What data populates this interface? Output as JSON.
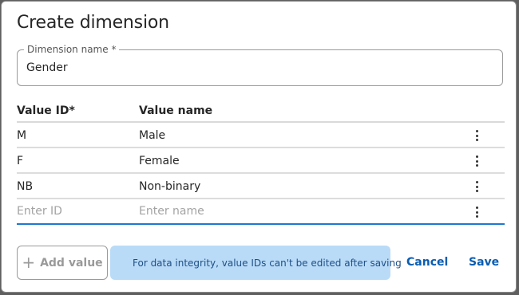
{
  "dialog": {
    "title": "Create dimension",
    "dimension_name": {
      "label": "Dimension name *",
      "value": "Gender"
    },
    "table": {
      "headers": {
        "value_id": "Value ID*",
        "value_name": "Value name"
      },
      "rows": [
        {
          "id": "M",
          "name": "Male"
        },
        {
          "id": "F",
          "name": "Female"
        },
        {
          "id": "NB",
          "name": "Non-binary"
        }
      ],
      "new_row": {
        "id_placeholder": "Enter ID",
        "name_placeholder": "Enter name"
      }
    },
    "add_button": {
      "icon": "plus-icon",
      "label": "Add value"
    },
    "notice": {
      "icon": "info-icon",
      "text": "For data integrity, value IDs can't be edited after saving",
      "background": "#b9dbf8"
    },
    "cancel_label": "Cancel",
    "save_label": "Save",
    "accent": "#0a5db1"
  }
}
